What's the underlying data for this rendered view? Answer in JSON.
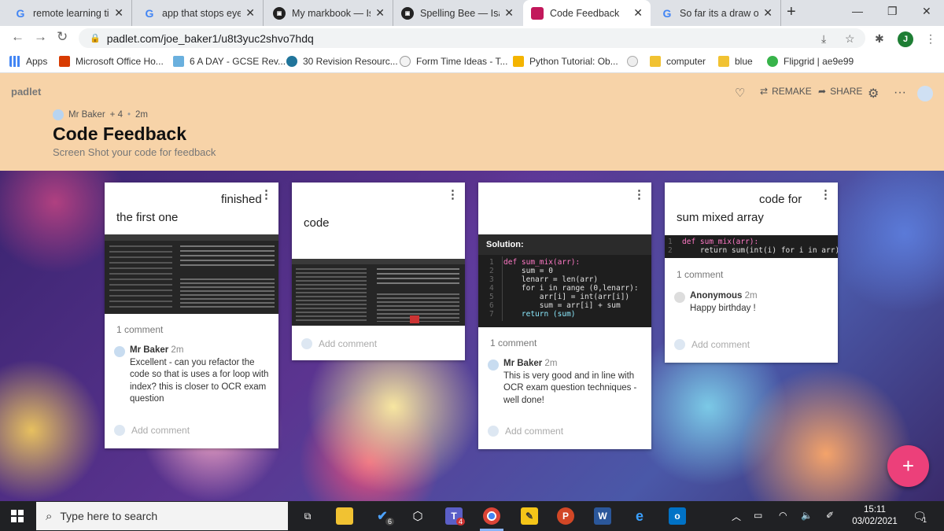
{
  "browser": {
    "tabs": [
      {
        "title": "remote learning tips",
        "favicon": "google-icon"
      },
      {
        "title": "app that stops eye m",
        "favicon": "google-icon"
      },
      {
        "title": "My markbook — Isaac",
        "favicon": "codesandbox-icon"
      },
      {
        "title": "Spelling Bee — Isaac",
        "favicon": "codesandbox-icon"
      },
      {
        "title": "Code Feedback",
        "favicon": "padlet-icon",
        "active": true
      },
      {
        "title": "So far its a draw on t",
        "favicon": "google-icon"
      }
    ],
    "url": "padlet.com/joe_baker1/u8t3yuc2shvo7hdq",
    "profile_initial": "J",
    "bookmarks": [
      {
        "label": "Apps",
        "icon": "apps-grid-icon"
      },
      {
        "label": "Microsoft Office Ho...",
        "icon": "office-icon"
      },
      {
        "label": "6 A DAY - GCSE Rev...",
        "icon": "gcse-icon"
      },
      {
        "label": "30 Revision Resourc...",
        "icon": "wordpress-icon"
      },
      {
        "label": "Form Time Ideas - T...",
        "icon": "lightbulb-icon"
      },
      {
        "label": "Python Tutorial: Ob...",
        "icon": "python-icon"
      },
      {
        "label": "",
        "icon": "pause-icon"
      },
      {
        "label": "computer",
        "icon": "folder-icon"
      },
      {
        "label": "blue",
        "icon": "folder-icon"
      },
      {
        "label": "Flipgrid | ae9e99",
        "icon": "flipgrid-icon"
      }
    ]
  },
  "padlet": {
    "logo": "padlet",
    "remake_label": "REMAKE",
    "share_label": "SHARE",
    "author": "Mr Baker",
    "contributors": "+ 4",
    "age": "2m",
    "title": "Code Feedback",
    "subtitle": "Screen Shot your code for feedback"
  },
  "cards": [
    {
      "title_line1": "finished",
      "title_line2": "the first one",
      "comment_count": "1 comment",
      "comment": {
        "author": "Mr Baker",
        "time": "2m",
        "text": "Excellent - can you refactor the code so that is uses a for loop with index? this is closer to OCR exam question"
      },
      "add_comment": "Add comment"
    },
    {
      "title_line1": "",
      "title_line2": "code",
      "add_comment": "Add comment"
    },
    {
      "solution_label": "Solution:",
      "code_lines": [
        "def sum_mix(arr):",
        "    sum = 0",
        "    lenarr = len(arr)",
        "    for i in range (0,lenarr):",
        "        arr[i] = int(arr[i])",
        "        sum = arr[i] + sum",
        "    return (sum)"
      ],
      "comment_count": "1 comment",
      "comment": {
        "author": "Mr Baker",
        "time": "2m",
        "text": "This is very good and in line with OCR exam question techniques - well done!"
      },
      "add_comment": "Add comment"
    },
    {
      "title_line1": "code for",
      "title_line2": "sum mixed array",
      "code_lines": [
        "def sum_mix(arr):",
        "    return sum(int(i) for i in arr)"
      ],
      "comment_count": "1 comment",
      "comment": {
        "author": "Anonymous",
        "time": "2m",
        "text": "Happy birthday !"
      },
      "add_comment": "Add comment"
    }
  ],
  "taskbar": {
    "search_placeholder": "Type here to search",
    "badge_tasks": "6",
    "badge_teams": "4",
    "time": "15:11",
    "date": "03/02/2021",
    "notifications": "1"
  }
}
